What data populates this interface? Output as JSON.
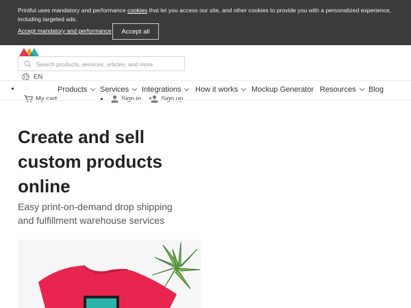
{
  "cookie_banner": {
    "text_before": "Printful uses mandatory and performance ",
    "text_link": "cookies",
    "text_after": " that let you access our site, and other cookies to provide you with a personalized experience, including targeted ads.",
    "accept_mandatory_label": "Accept mandatory and performance",
    "accept_all_label": "Accept all"
  },
  "search": {
    "placeholder": "Search products, services, articles, and more",
    "value": ""
  },
  "language": {
    "label": "EN"
  },
  "nav": {
    "items": [
      {
        "label": "Products",
        "has_dropdown": true
      },
      {
        "label": "Services",
        "has_dropdown": true
      },
      {
        "label": "Integrations",
        "has_dropdown": true
      },
      {
        "label": "How it works",
        "has_dropdown": true
      },
      {
        "label": "Mockup Generator",
        "has_dropdown": false
      },
      {
        "label": "Resources",
        "has_dropdown": true
      },
      {
        "label": "Blog",
        "has_dropdown": false
      }
    ]
  },
  "utility": {
    "cart_label": "My cart",
    "signin_label": "Sign in",
    "signup_label": "Sign up"
  },
  "hero": {
    "title_line1": "Create and sell",
    "title_line2": "custom products",
    "title_line3": "online",
    "subtitle_line1": "Easy print-on-demand drop shipping",
    "subtitle_line2": "and fulfillment warehouse services"
  },
  "colors": {
    "banner_bg": "#3b3b3b",
    "text_dark": "#222222",
    "shirt": "#e8254f",
    "logo_red": "#e8354b",
    "logo_orange": "#f49b2a",
    "logo_teal": "#2ab3a8"
  },
  "icons": [
    "search-icon",
    "globe-icon",
    "chevron-down-icon",
    "cart-icon",
    "user-icon",
    "add-user-icon"
  ]
}
